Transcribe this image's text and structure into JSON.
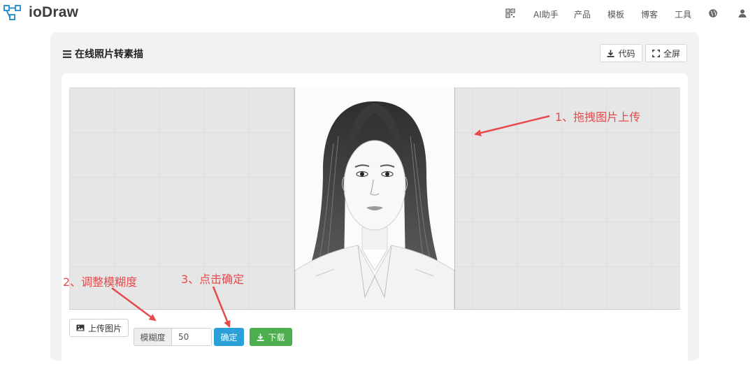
{
  "brand": {
    "name": "ioDraw"
  },
  "nav": {
    "items": [
      {
        "label": "AI助手"
      },
      {
        "label": "产品"
      },
      {
        "label": "模板"
      },
      {
        "label": "博客"
      },
      {
        "label": "工具"
      }
    ]
  },
  "panel": {
    "title": "在线照片转素描",
    "code_button": "代码",
    "fullscreen_button": "全屏"
  },
  "controls": {
    "upload_button": "上传图片",
    "blur_label": "模糊度",
    "blur_value": "50",
    "confirm_button": "确定",
    "download_button": "下载"
  },
  "annotations": {
    "step1": "1、拖拽图片上传",
    "step2": "2、调整模糊度",
    "step3": "3、点击确定"
  },
  "colors": {
    "annotation": "#e8494b",
    "confirm": "#2a9fd8",
    "download": "#4cae4c",
    "brand_icon": "#1e88c8"
  }
}
